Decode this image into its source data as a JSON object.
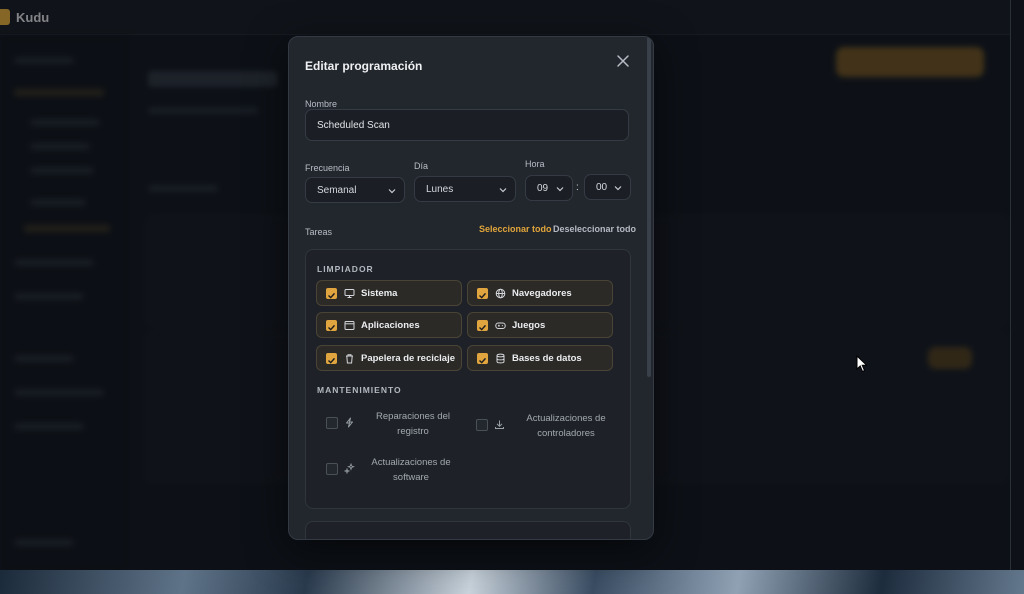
{
  "app": {
    "name": "Kudu"
  },
  "modal": {
    "title": "Editar programación",
    "name_label": "Nombre",
    "name_value": "Scheduled Scan",
    "frequency_label": "Frecuencia",
    "frequency_value": "Semanal",
    "day_label": "Día",
    "day_value": "Lunes",
    "time_label": "Hora",
    "hour_value": "09",
    "minute_value": "00",
    "time_separator": ":",
    "tasks_label": "Tareas",
    "select_all": "Seleccionar todo",
    "deselect_all": "Deseleccionar todo",
    "cleaner": {
      "title": "LIMPIADOR",
      "items": [
        {
          "label": "Sistema",
          "icon": "monitor-icon",
          "checked": true
        },
        {
          "label": "Navegadores",
          "icon": "globe-icon",
          "checked": true
        },
        {
          "label": "Aplicaciones",
          "icon": "window-icon",
          "checked": true
        },
        {
          "label": "Juegos",
          "icon": "gamepad-icon",
          "checked": true
        },
        {
          "label": "Papelera de reciclaje",
          "icon": "trash-icon",
          "checked": true
        },
        {
          "label": "Bases de datos",
          "icon": "database-icon",
          "checked": true
        }
      ]
    },
    "maintenance": {
      "title": "MANTENIMIENTO",
      "items": [
        {
          "label": "Reparaciones del registro",
          "icon": "bolt-icon",
          "checked": false
        },
        {
          "label": "Actualizaciones de controladores",
          "icon": "download-icon",
          "checked": false
        },
        {
          "label": "Actualizaciones de software",
          "icon": "sparkles-icon",
          "checked": false
        }
      ]
    }
  },
  "colors": {
    "accent": "#e2a53a",
    "modal_bg": "#22272e",
    "panel_bg": "#1e2228"
  }
}
